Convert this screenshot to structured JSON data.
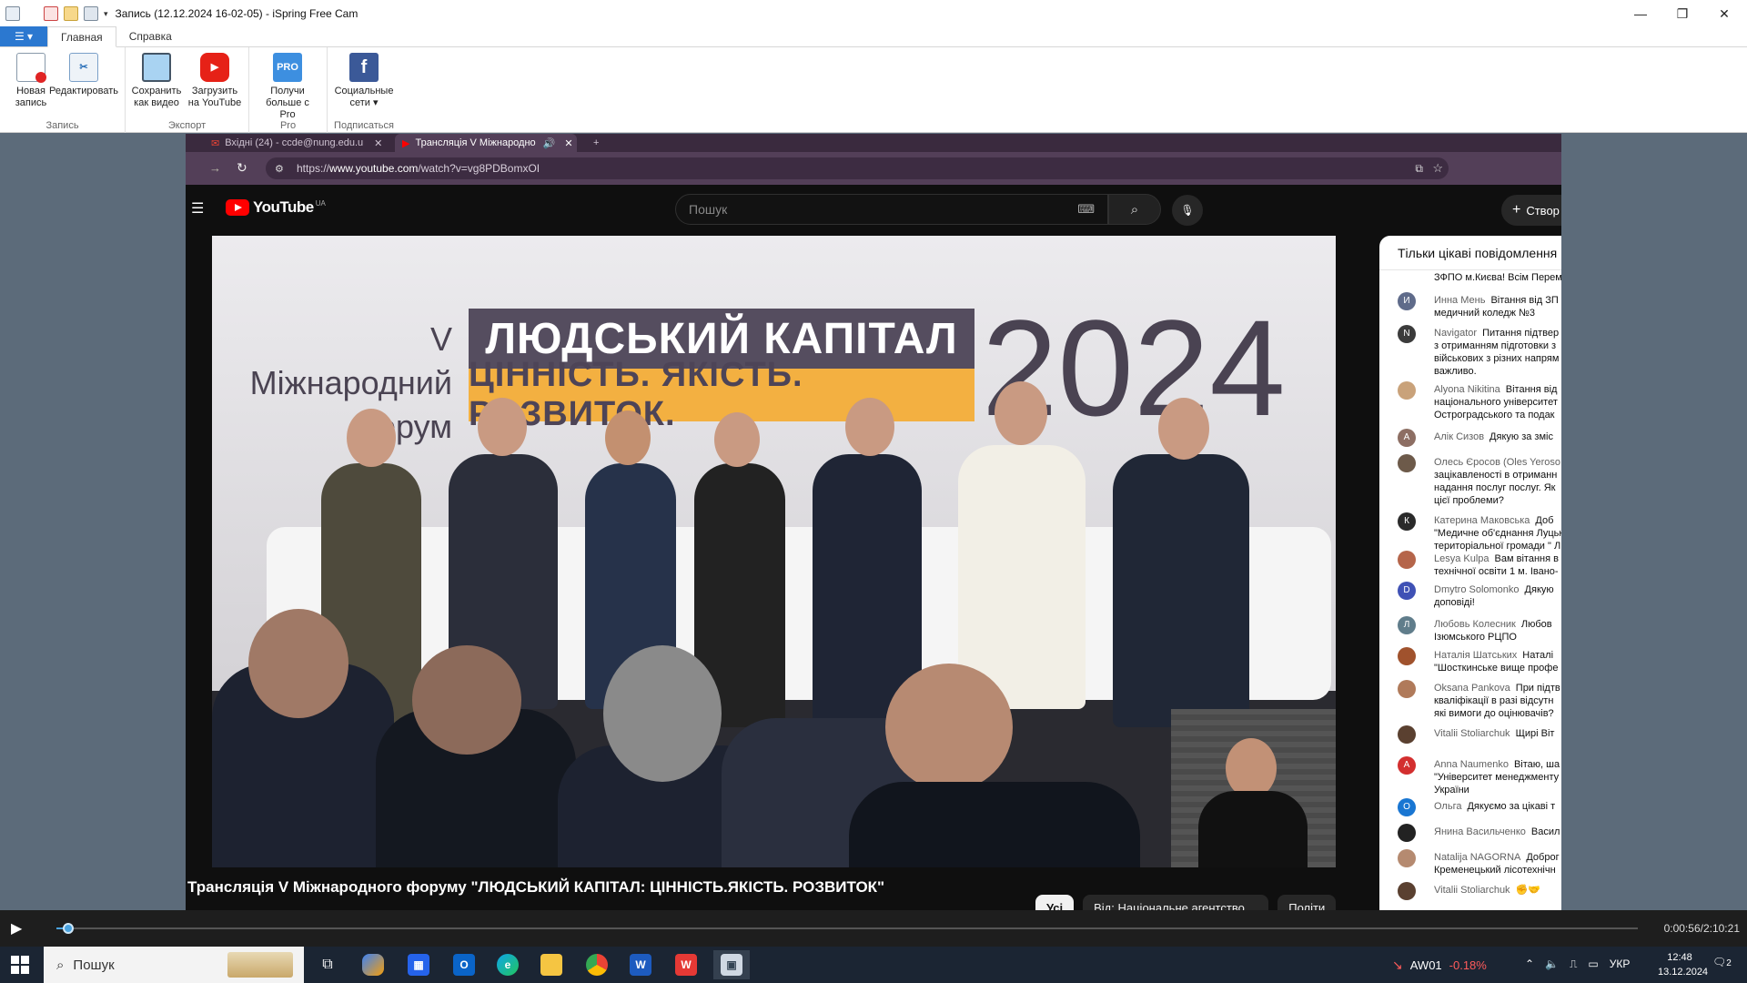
{
  "window": {
    "title": "Запись (12.12.2024 16-02-05) - iSpring Free Cam",
    "minimize": "—",
    "maximize": "❐",
    "close": "✕"
  },
  "ribbon": {
    "tabs": [
      "Главная",
      "Справка"
    ],
    "groups": [
      {
        "label": "Запись",
        "buttons": [
          {
            "label": "Новая запись",
            "icon": "new-record-icon"
          },
          {
            "label": "Редактировать",
            "icon": "edit-icon"
          }
        ]
      },
      {
        "label": "Экспорт",
        "buttons": [
          {
            "label": "Сохранить как видео",
            "icon": "film-icon"
          },
          {
            "label": "Загрузить на YouTube",
            "icon": "youtube-icon"
          }
        ]
      },
      {
        "label": "Pro",
        "buttons": [
          {
            "label": "Получи больше с Pro",
            "icon": "pro-icon",
            "icon_text": "PRO"
          }
        ]
      },
      {
        "label": "Подписаться",
        "buttons": [
          {
            "label": "Социальные сети",
            "icon": "facebook-icon",
            "icon_text": "f"
          }
        ]
      }
    ]
  },
  "browser": {
    "tabs": [
      {
        "label": "Вхідні (24) - ccde@nung.edu.u"
      },
      {
        "label": "Трансляція V Міжнародно"
      }
    ],
    "url_prefix": "https://",
    "url_host": "www.youtube.com",
    "url_path": "/watch?v=vg8PDBomxOI"
  },
  "youtube": {
    "logo_text": "YouTube",
    "region": "UA",
    "search_placeholder": "Пошук",
    "create_label": "Створ",
    "video_title": "Трансляція V Міжнародного форуму \"ЛЮДСЬКИЙ КАПІТАЛ: ЦІННІСТЬ.ЯКІСТЬ. РОЗВИТОК\"",
    "chips": [
      "Усі",
      "Від: Національне агентство ...",
      "Політи"
    ]
  },
  "video_scene": {
    "forum_line1": "V Міжнародний",
    "forum_line2": "форум",
    "banner_title": "ЛЮДСЬКИЙ КАПІТАЛ",
    "banner_sub": "ЦІННІСТЬ. ЯКІСТЬ. РОЗВИТОК.",
    "year": "2024"
  },
  "chat": {
    "header": "Тільки цікаві повідомлення",
    "top_fragment": "ЗФПО м.Києва! Всім Перем",
    "messages": [
      {
        "author": "Инна Мень",
        "text": "Вітання від ЗП",
        "line2": "медичний коледж №3",
        "avatar_letter": "И",
        "avatar_color": "#5f6b8a"
      },
      {
        "author": "Navigator",
        "text": "Питання підтвер",
        "line2": "з отриманням підготовки з",
        "line3": "військових з різних напрям",
        "line4": "важливо.",
        "avatar_letter": "N",
        "avatar_color": "#3b3b3b"
      },
      {
        "author": "Alyona Nikitina",
        "text": "Вітання від",
        "line2": "національного університет",
        "line3": "Остроградського та подак",
        "avatar_letter": "",
        "avatar_color": "#c9a27a"
      },
      {
        "author": "Алік Сизов",
        "text": "Дякую за зміс",
        "avatar_letter": "А",
        "avatar_color": "#8d6e63"
      },
      {
        "author": "Олесь Єросов (Oles Yeroso",
        "text": "",
        "line2": "зацікавленості в отриманн",
        "line3": "надання послуг послуг. Як",
        "line4": "цієї проблеми?",
        "avatar_letter": "",
        "avatar_color": "#6d5a4a"
      },
      {
        "author": "Катерина Маковська",
        "text": "Доб",
        "line2": "\"Медичне об'єднання Луцьк",
        "line3": "територіальної громади \" Л",
        "avatar_letter": "К",
        "avatar_color": "#2a2a2a"
      },
      {
        "author": "Lesya Kulpa",
        "text": "Вам вітання в",
        "line2": "технічної освіти 1 м. Івано-",
        "avatar_letter": "",
        "avatar_color": "#b5654a"
      },
      {
        "author": "Dmytro Solomonko",
        "text": "Дякую",
        "line2": "доповіді!",
        "avatar_letter": "D",
        "avatar_color": "#3f51b5"
      },
      {
        "author": "Любовь Колесник",
        "text": "Любов",
        "line2": "Ізюмського РЦПО",
        "avatar_letter": "Л",
        "avatar_color": "#607d8b"
      },
      {
        "author": "Наталія Шатських",
        "text": "Наталі",
        "line2": "\"Шосткинське вище профе",
        "avatar_letter": "",
        "avatar_color": "#a0522d"
      },
      {
        "author": "Oksana Pankova",
        "text": "При підтв",
        "line2": "кваліфікації в разі відсутн",
        "line3": "які вимоги до оцінювачів?",
        "avatar_letter": "",
        "avatar_color": "#b07a5a"
      },
      {
        "author": "Vitalii Stoliarchuk",
        "text": "Щирі Віт",
        "avatar_letter": "",
        "avatar_color": "#5a4030"
      },
      {
        "author": "Anna Naumenko",
        "text": "Вітаю, ша",
        "line2": "\"Університет менеджменту",
        "line3": "України",
        "avatar_letter": "A",
        "avatar_color": "#d32f2f"
      },
      {
        "author": "Ольга",
        "text": "Дякуємо за цікаві т",
        "avatar_letter": "О",
        "avatar_color": "#1976d2"
      },
      {
        "author": "Янина Васильченко",
        "text": "Васил",
        "avatar_letter": "",
        "avatar_color": "#222"
      },
      {
        "author": "Natalija NAGORNA",
        "text": "Доброг",
        "line2": "Кременецький лісотехнічн",
        "avatar_letter": "",
        "avatar_color": "#b58a70"
      },
      {
        "author": "Vitalii Stoliarchuk",
        "text": "✊🤝",
        "avatar_letter": "",
        "avatar_color": "#5a4030"
      }
    ]
  },
  "player": {
    "time": "0:00:56/2:10:21",
    "progress": 0.0072
  },
  "taskbar": {
    "search_placeholder": "Пошук",
    "ticker_symbol": "AW01",
    "ticker_change": "-0.18%",
    "lang": "УКР",
    "time": "12:48",
    "date": "13.12.2024",
    "notifications": "2"
  }
}
